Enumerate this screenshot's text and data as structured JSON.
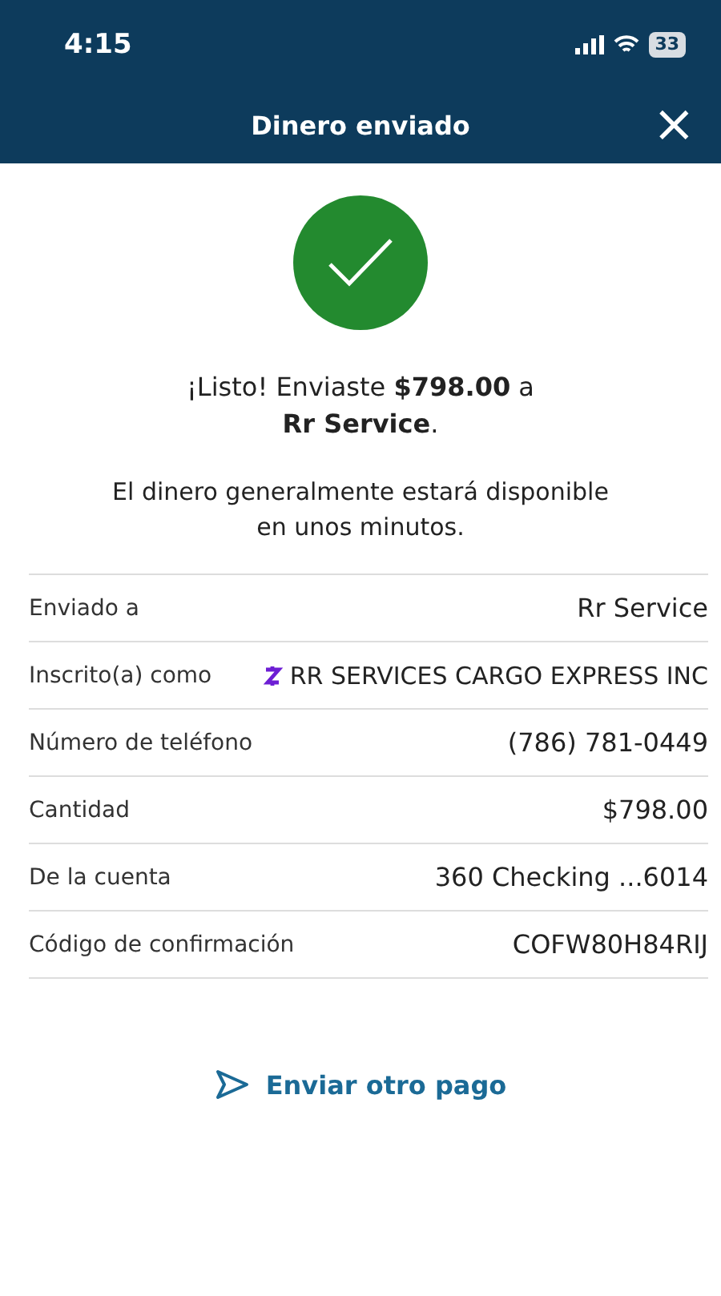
{
  "status_bar": {
    "time": "4:15",
    "battery": "33"
  },
  "header": {
    "title": "Dinero enviado",
    "close": "×"
  },
  "message": "¡Listo! Enviaste **$798.00** a\n**Rr Service**.",
  "note": "El dinero generalmente estará disponible\nen unos minutos.",
  "details": [
    {
      "kind": "plain",
      "label": "Enviado a",
      "value": "Rr Service"
    },
    {
      "kind": "zelle",
      "label": "Inscrito(a) como",
      "value": "RR SERVICES CARGO EXPRESS INC"
    },
    {
      "kind": "plain",
      "label": "Número de teléfono",
      "value": "(786) 781-0449"
    },
    {
      "kind": "plain",
      "label": "Cantidad",
      "value": "$798.00"
    },
    {
      "kind": "plain",
      "label": "De la cuenta",
      "value": "360 Checking ...6014"
    },
    {
      "kind": "plain",
      "label": "Código de confirmación",
      "value": "COFW80H84RIJ"
    }
  ],
  "action": {
    "label": "Enviar otro pago"
  }
}
